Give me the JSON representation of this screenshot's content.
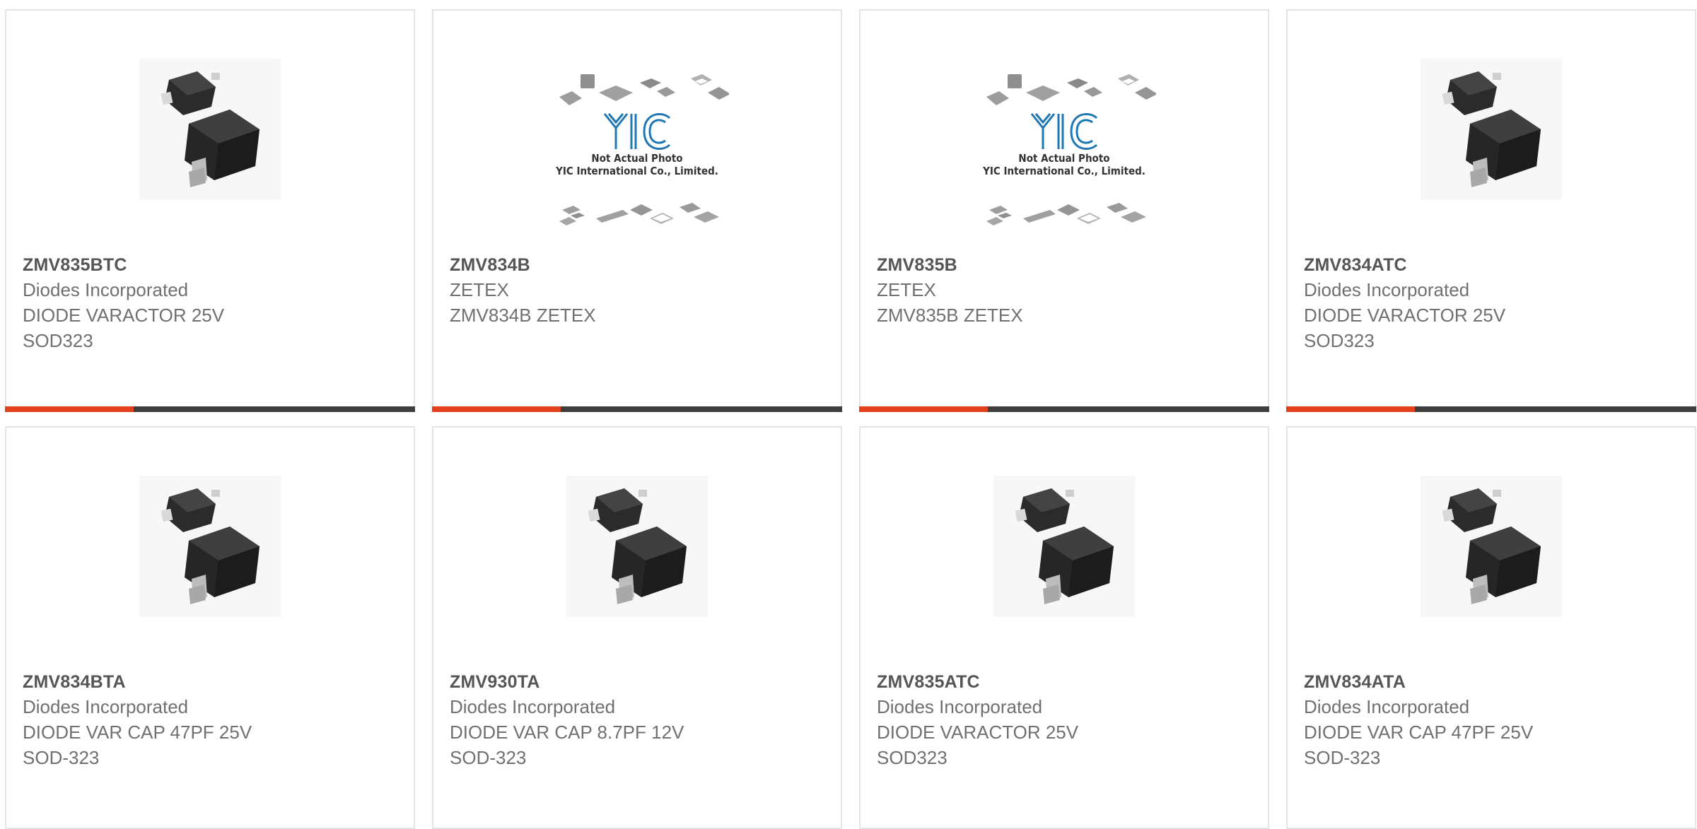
{
  "colors": {
    "accent": "#e3411c",
    "bar": "#3e3e3e",
    "border": "#e4e4e4",
    "title": "#555555",
    "text": "#707070"
  },
  "products": [
    {
      "part": "ZMV835BTC",
      "maker": "Diodes Incorporated",
      "desc": "DIODE VARACTOR 25V",
      "pkg": "SOD323",
      "image": "sod323-diode-icon"
    },
    {
      "part": "ZMV834B",
      "maker": "ZETEX",
      "desc": "ZMV834B ZETEX",
      "pkg": "",
      "image": "yic-placeholder-icon"
    },
    {
      "part": "ZMV835B",
      "maker": "ZETEX",
      "desc": "ZMV835B ZETEX",
      "pkg": "",
      "image": "yic-placeholder-icon"
    },
    {
      "part": "ZMV834ATC",
      "maker": "Diodes Incorporated",
      "desc": "DIODE VARACTOR 25V",
      "pkg": "SOD323",
      "image": "sod323-diode-icon"
    },
    {
      "part": "ZMV834BTA",
      "maker": "Diodes Incorporated",
      "desc": "DIODE VAR CAP 47PF 25V",
      "pkg": "SOD-323",
      "image": "sod323-diode-icon"
    },
    {
      "part": "ZMV930TA",
      "maker": "Diodes Incorporated",
      "desc": "DIODE VAR CAP 8.7PF 12V",
      "pkg": "SOD-323",
      "image": "sod323-diode-icon"
    },
    {
      "part": "ZMV835ATC",
      "maker": "Diodes Incorporated",
      "desc": "DIODE VARACTOR 25V",
      "pkg": "SOD323",
      "image": "sod323-diode-icon"
    },
    {
      "part": "ZMV834ATA",
      "maker": "Diodes Incorporated",
      "desc": "DIODE VAR CAP 47PF 25V",
      "pkg": "SOD-323",
      "image": "sod323-diode-icon"
    }
  ],
  "placeholder": {
    "logo": "YIC",
    "line1": "Not Actual Photo",
    "line2": "YIC International Co., Limited."
  }
}
